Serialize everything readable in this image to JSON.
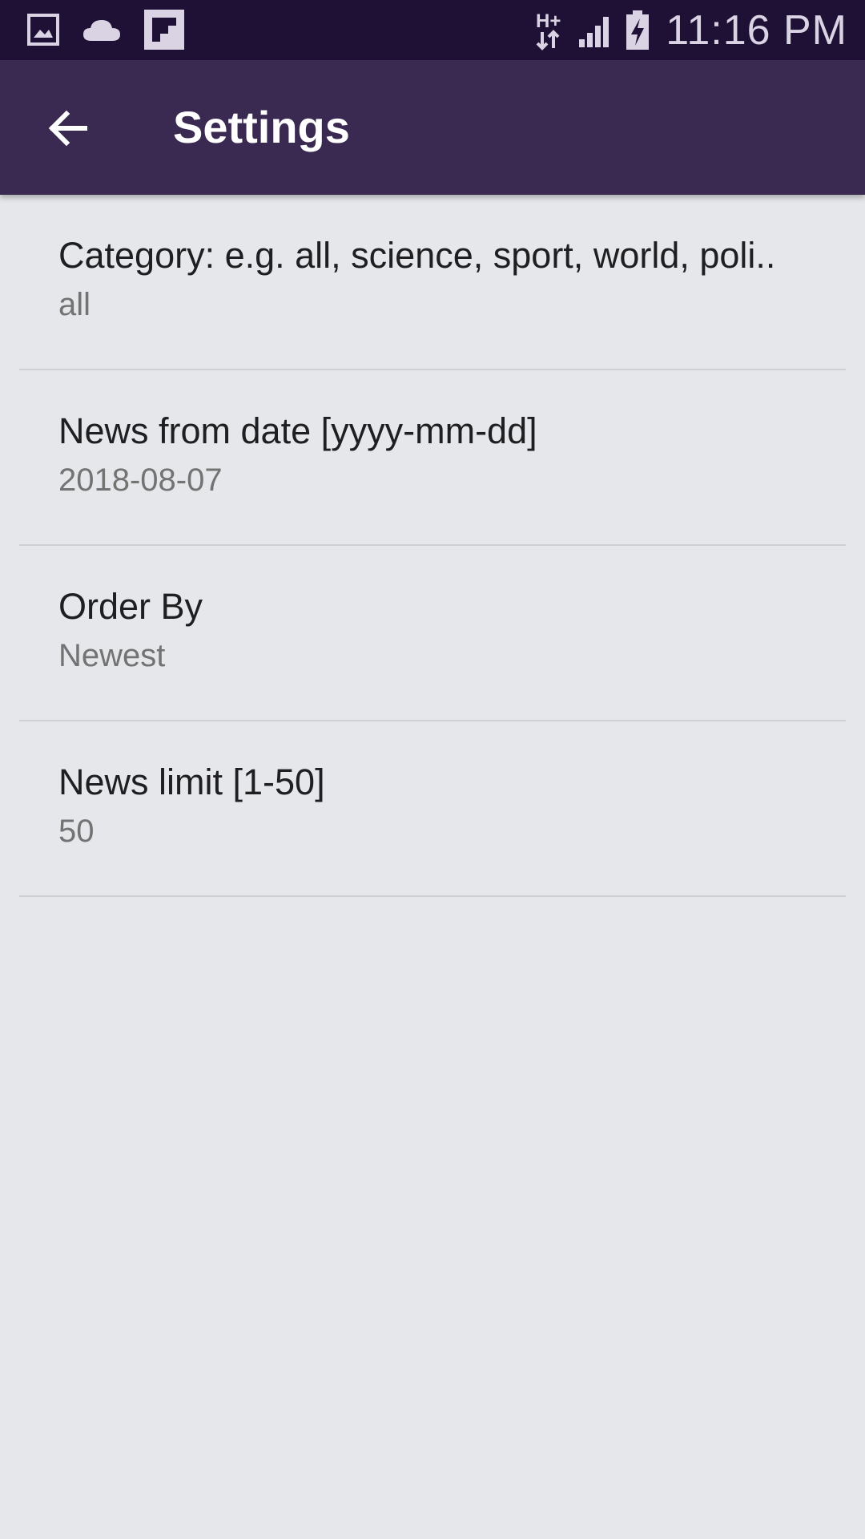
{
  "status_bar": {
    "time": "11:16 PM",
    "left_icons": [
      "gallery-icon",
      "cloud-icon",
      "flipboard-icon"
    ],
    "network_label": "H+"
  },
  "app_bar": {
    "title": "Settings",
    "back_icon": "arrow-back-icon",
    "background": "#3a2a52"
  },
  "preferences": [
    {
      "title": "Category: e.g. all, science, sport, world, poli..",
      "summary": "all"
    },
    {
      "title": "News from date [yyyy-mm-dd]",
      "summary": "2018-08-07"
    },
    {
      "title": "Order By",
      "summary": "Newest"
    },
    {
      "title": "News limit [1-50]",
      "summary": "50"
    }
  ],
  "colors": {
    "status_bar": "#1f1136",
    "background": "#e6e7ea",
    "divider": "#cfd0d3"
  }
}
